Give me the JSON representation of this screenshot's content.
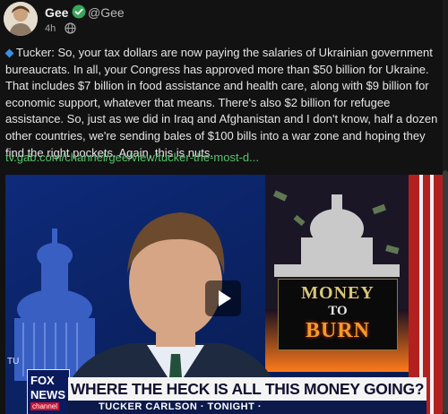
{
  "post": {
    "author_name": "Gee",
    "author_handle": "@Gee",
    "timestamp": "4h",
    "visibility_icon": "globe-icon",
    "body_text": "Tucker: So, your tax dollars are now paying the salaries of Ukrainian government bureaucrats. In all, your Congress has approved more than $50 billion for Ukraine. That includes $7 billion in food assistance and health care, along with $9 billion for economic support, whatever that means. There's also $2 billion for refugee assistance. So, just as we did in Iraq and Afghanistan and I don't know, half a dozen other countries, we're sending bales of $100 bills into a war zone and hoping they find the right pockets. Again, this is nuts.",
    "link_text": "tv.gab.com/channel/gee/view/tucker-the-most-d...",
    "accent_link_color": "#56c46a",
    "bullet_color": "#3b8fe0"
  },
  "video": {
    "graphic_title_line1": "MONEY",
    "graphic_title_line2": "TO",
    "graphic_title_line3": "BURN",
    "chyron": "WHERE THE HECK IS ALL THIS MONEY GOING?",
    "show_name": "TUCKER CARLSON · TONIGHT ·",
    "network_line1": "FOX",
    "network_line2": "NEWS",
    "network_line3": "channel",
    "side_text": "TU"
  }
}
